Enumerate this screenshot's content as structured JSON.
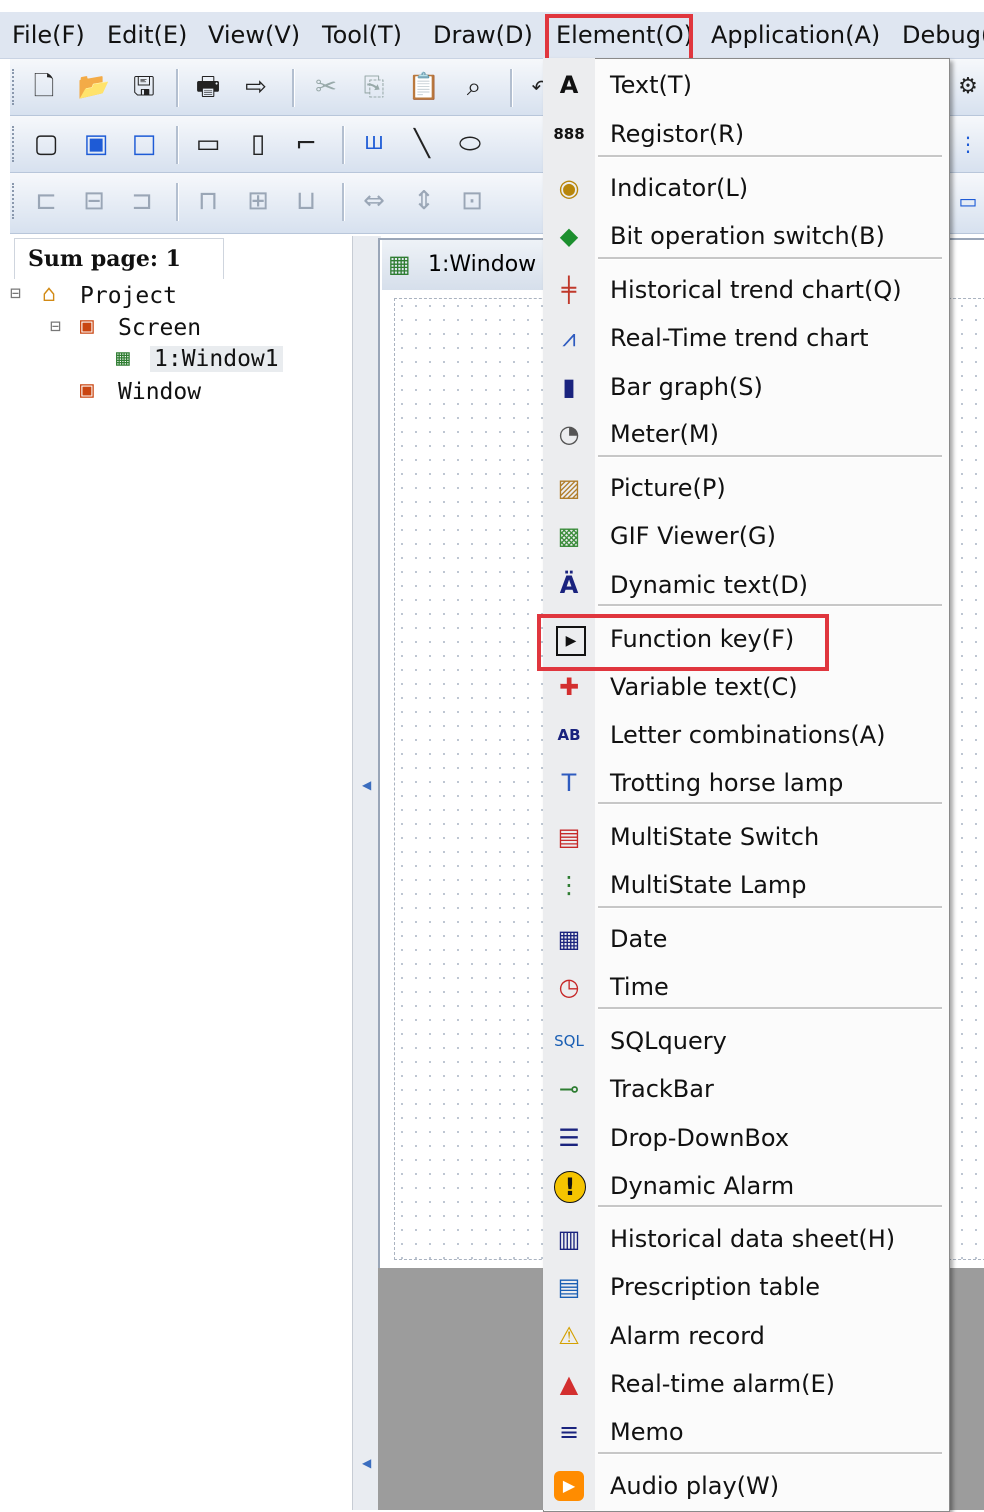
{
  "menubar": {
    "file": "File(F)",
    "edit": "Edit(E)",
    "view": "View(V)",
    "tool": "Tool(T)",
    "draw": "Draw(D)",
    "element": "Element(O)",
    "application": "Application(A)",
    "debug": "Debug("
  },
  "tree": {
    "sum_page": "Sum page: 1",
    "project": "Project",
    "screen": "Screen",
    "window1": "1:Window1",
    "window": "Window"
  },
  "document": {
    "tab_title": "1:Window"
  },
  "element_menu": {
    "items": [
      {
        "label": "Text(T)",
        "icon": "text-A-icon"
      },
      {
        "label": "Registor(R)",
        "icon": "register-digits-icon"
      },
      {
        "label": "Indicator(L)",
        "icon": "indicator-lamp-icon"
      },
      {
        "label": "Bit operation switch(B)",
        "icon": "bit-switch-icon"
      },
      {
        "label": "Historical trend chart(Q)",
        "icon": "historical-trend-icon"
      },
      {
        "label": "Real-Time trend chart",
        "icon": "realtime-trend-icon"
      },
      {
        "label": "Bar graph(S)",
        "icon": "bar-graph-icon"
      },
      {
        "label": "Meter(M)",
        "icon": "meter-icon"
      },
      {
        "label": "Picture(P)",
        "icon": "picture-icon"
      },
      {
        "label": "GIF Viewer(G)",
        "icon": "gif-viewer-icon"
      },
      {
        "label": "Dynamic text(D)",
        "icon": "dynamic-text-icon"
      },
      {
        "label": "Function key(F)",
        "icon": "function-key-icon"
      },
      {
        "label": "Variable text(C)",
        "icon": "variable-text-icon"
      },
      {
        "label": "Letter combinations(A)",
        "icon": "letter-combinations-icon"
      },
      {
        "label": "Trotting horse lamp",
        "icon": "marquee-text-icon"
      },
      {
        "label": "MultiState Switch",
        "icon": "multistate-switch-icon"
      },
      {
        "label": "MultiState Lamp",
        "icon": "multistate-lamp-icon"
      },
      {
        "label": "Date",
        "icon": "calendar-icon"
      },
      {
        "label": "Time",
        "icon": "clock-icon"
      },
      {
        "label": "SQLquery",
        "icon": "sql-query-icon"
      },
      {
        "label": "TrackBar",
        "icon": "trackbar-icon"
      },
      {
        "label": "Drop-DownBox",
        "icon": "dropdown-box-icon"
      },
      {
        "label": "Dynamic Alarm",
        "icon": "dynamic-alarm-icon"
      },
      {
        "label": "Historical data sheet(H)",
        "icon": "data-sheet-icon"
      },
      {
        "label": "Prescription table",
        "icon": "recipe-table-icon"
      },
      {
        "label": "Alarm record",
        "icon": "alarm-record-icon"
      },
      {
        "label": "Real-time alarm(E)",
        "icon": "realtime-alarm-icon"
      },
      {
        "label": "Memo",
        "icon": "memo-icon"
      },
      {
        "label": "Audio play(W)",
        "icon": "audio-play-icon"
      }
    ]
  },
  "highlight_color": "#e0363e"
}
